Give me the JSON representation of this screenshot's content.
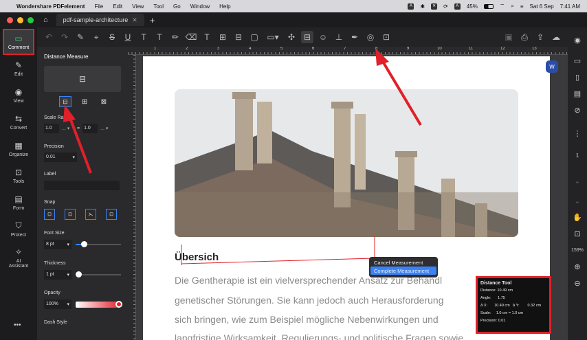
{
  "menubar": {
    "app": "Wondershare PDFelement",
    "items": [
      "File",
      "Edit",
      "View",
      "Tool",
      "Go",
      "Window",
      "Help"
    ],
    "battery": "45%",
    "date": "Sat 6 Sep",
    "time": "7:41 AM",
    "input_source": "A"
  },
  "tab": {
    "title": "pdf-sample-architecture"
  },
  "leftnav": [
    {
      "label": "Comment",
      "icon": "comment-icon"
    },
    {
      "label": "Edit",
      "icon": "edit-icon"
    },
    {
      "label": "View",
      "icon": "eye-icon"
    },
    {
      "label": "Convert",
      "icon": "convert-icon"
    },
    {
      "label": "Organize",
      "icon": "organize-icon"
    },
    {
      "label": "Tools",
      "icon": "tools-icon"
    },
    {
      "label": "Form",
      "icon": "form-icon"
    },
    {
      "label": "Protect",
      "icon": "shield-icon"
    },
    {
      "label": "AI Assistant",
      "icon": "ai-icon"
    }
  ],
  "panel": {
    "title": "Distance Measure",
    "scale_ratio_label": "Scale Ratio",
    "scale_left": "1.0",
    "scale_right": "1.0",
    "precision_label": "Precision",
    "precision_value": "0.01",
    "label_label": "Label",
    "snap_label": "Snap",
    "font_size_label": "Font Size",
    "font_size_value": "8 pt",
    "thickness_label": "Thickness",
    "thickness_value": "1 pt",
    "opacity_label": "Opacity",
    "opacity_value": "100%",
    "dash_style_label": "Dash Style"
  },
  "document": {
    "heading": "Übersich",
    "lines": [
      "Die Gentherapie ist ein vielversprechender Ansatz zur Behandl",
      "genetischer Störungen. Sie kann jedoch auch Herausforderung",
      "sich bringen, wie zum Beispiel mögliche Nebenwirkungen und",
      "langfristige Wirksamkeit, Regulierungs- und politische Fragen sowie"
    ]
  },
  "context_menu": {
    "cancel": "Cancel Measurement",
    "complete": "Complete Measurement"
  },
  "distance_tool": {
    "title": "Distance Tool",
    "distance_label": "Distance:",
    "distance_value": "10.49 cm",
    "angle_label": "Angle:",
    "angle_value": "1.75",
    "dx_label": "Δ X:",
    "dx_value": "10.49 cm",
    "dy_label": "Δ Y:",
    "dy_value": "0.32 cm",
    "scale_label": "Scale:",
    "scale_value": "1.0 cm = 1.0 cm",
    "precision_label": "Precision:",
    "precision_value": "0.01"
  },
  "rightbar": {
    "page_number": "1",
    "zoom": "159%"
  },
  "colors": {
    "accent": "#3a82f7",
    "annotation": "#e0202a"
  }
}
